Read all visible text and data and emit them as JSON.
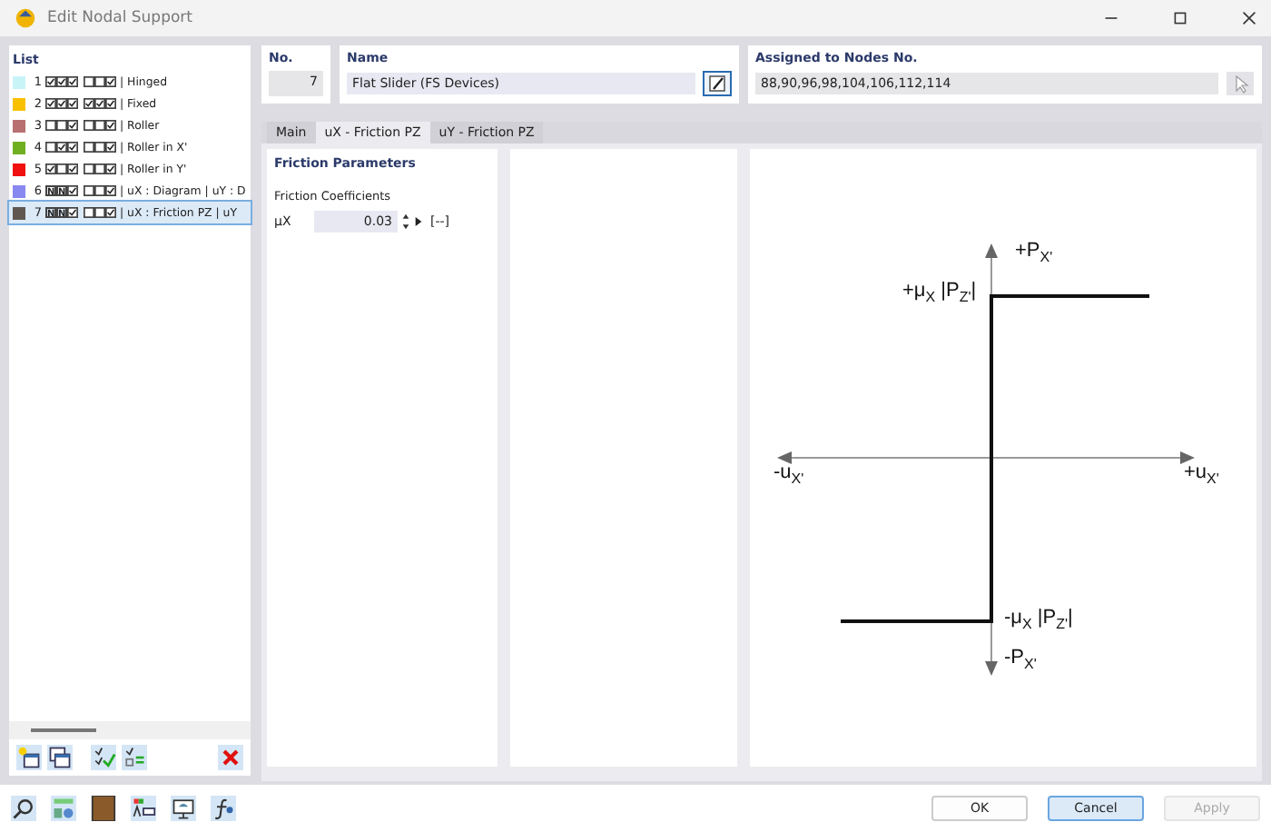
{
  "window": {
    "title": "Edit Nodal Support"
  },
  "list": {
    "title": "List",
    "items": [
      {
        "number": "1",
        "color": "#c8f4f8",
        "boxes": [
          {
            "kind": "checked"
          },
          {
            "kind": "checked"
          },
          {
            "kind": "checked"
          },
          {
            "kind": "empty"
          },
          {
            "kind": "empty"
          },
          {
            "kind": "checked"
          }
        ],
        "label": "| Hinged",
        "selected": false
      },
      {
        "number": "2",
        "color": "#f8c000",
        "boxes": [
          {
            "kind": "checked"
          },
          {
            "kind": "checked"
          },
          {
            "kind": "checked"
          },
          {
            "kind": "checked"
          },
          {
            "kind": "checked"
          },
          {
            "kind": "checked"
          }
        ],
        "label": "| Fixed",
        "selected": false
      },
      {
        "number": "3",
        "color": "#b87070",
        "boxes": [
          {
            "kind": "empty"
          },
          {
            "kind": "empty"
          },
          {
            "kind": "checked"
          },
          {
            "kind": "empty"
          },
          {
            "kind": "empty"
          },
          {
            "kind": "checked"
          }
        ],
        "label": "| Roller",
        "selected": false
      },
      {
        "number": "4",
        "color": "#70b020",
        "boxes": [
          {
            "kind": "empty"
          },
          {
            "kind": "checked"
          },
          {
            "kind": "checked"
          },
          {
            "kind": "empty"
          },
          {
            "kind": "empty"
          },
          {
            "kind": "checked"
          }
        ],
        "label": "| Roller in X'",
        "selected": false
      },
      {
        "number": "5",
        "color": "#f01010",
        "boxes": [
          {
            "kind": "checked"
          },
          {
            "kind": "empty"
          },
          {
            "kind": "checked"
          },
          {
            "kind": "empty"
          },
          {
            "kind": "empty"
          },
          {
            "kind": "checked"
          }
        ],
        "label": "| Roller in Y'",
        "selected": false
      },
      {
        "number": "6",
        "color": "#8888f0",
        "boxes": [
          {
            "kind": "letter",
            "text": "N"
          },
          {
            "kind": "letter",
            "text": "N"
          },
          {
            "kind": "checked"
          },
          {
            "kind": "empty"
          },
          {
            "kind": "empty"
          },
          {
            "kind": "checked"
          }
        ],
        "label": "| uX : Diagram | uY : D",
        "selected": false
      },
      {
        "number": "7",
        "color": "#605850",
        "boxes": [
          {
            "kind": "letter",
            "text": "N"
          },
          {
            "kind": "letter",
            "text": "N"
          },
          {
            "kind": "checked"
          },
          {
            "kind": "empty"
          },
          {
            "kind": "empty"
          },
          {
            "kind": "checked"
          }
        ],
        "label": "| uX : Friction PZ | uY",
        "selected": true
      }
    ]
  },
  "number": {
    "label": "No.",
    "value": "7"
  },
  "name": {
    "label": "Name",
    "value": "Flat Slider (FS Devices)"
  },
  "assigned": {
    "label": "Assigned to Nodes No.",
    "value": "88,90,96,98,104,106,112,114"
  },
  "tabs": [
    {
      "label": "Main",
      "selected": false
    },
    {
      "label": "uX - Friction PZ",
      "selected": true
    },
    {
      "label": "uY - Friction PZ",
      "selected": false
    }
  ],
  "friction": {
    "title": "Friction Parameters",
    "group": "Friction Coefficients",
    "symbol": "μX",
    "value": "0.03",
    "unit": "[--]"
  },
  "diagram": {
    "labels": [
      {
        "kind": "top",
        "text": "+P$_{X'}$"
      },
      {
        "kind": "upper",
        "text": "+μ$_{X}$ |P$_{Z'}$|"
      },
      {
        "kind": "left",
        "text": "-u$_{X'}$"
      },
      {
        "kind": "right",
        "text": "+u$_{X'}$"
      },
      {
        "kind": "lower",
        "text": "-μ$_{X}$ |P$_{Z'}$|"
      },
      {
        "kind": "bottom",
        "text": "-P$_{X'}$"
      }
    ]
  },
  "buttons": [
    {
      "label": "OK",
      "kind": "normal"
    },
    {
      "label": "Cancel",
      "kind": "default"
    },
    {
      "label": "Apply",
      "kind": "disabled"
    }
  ]
}
